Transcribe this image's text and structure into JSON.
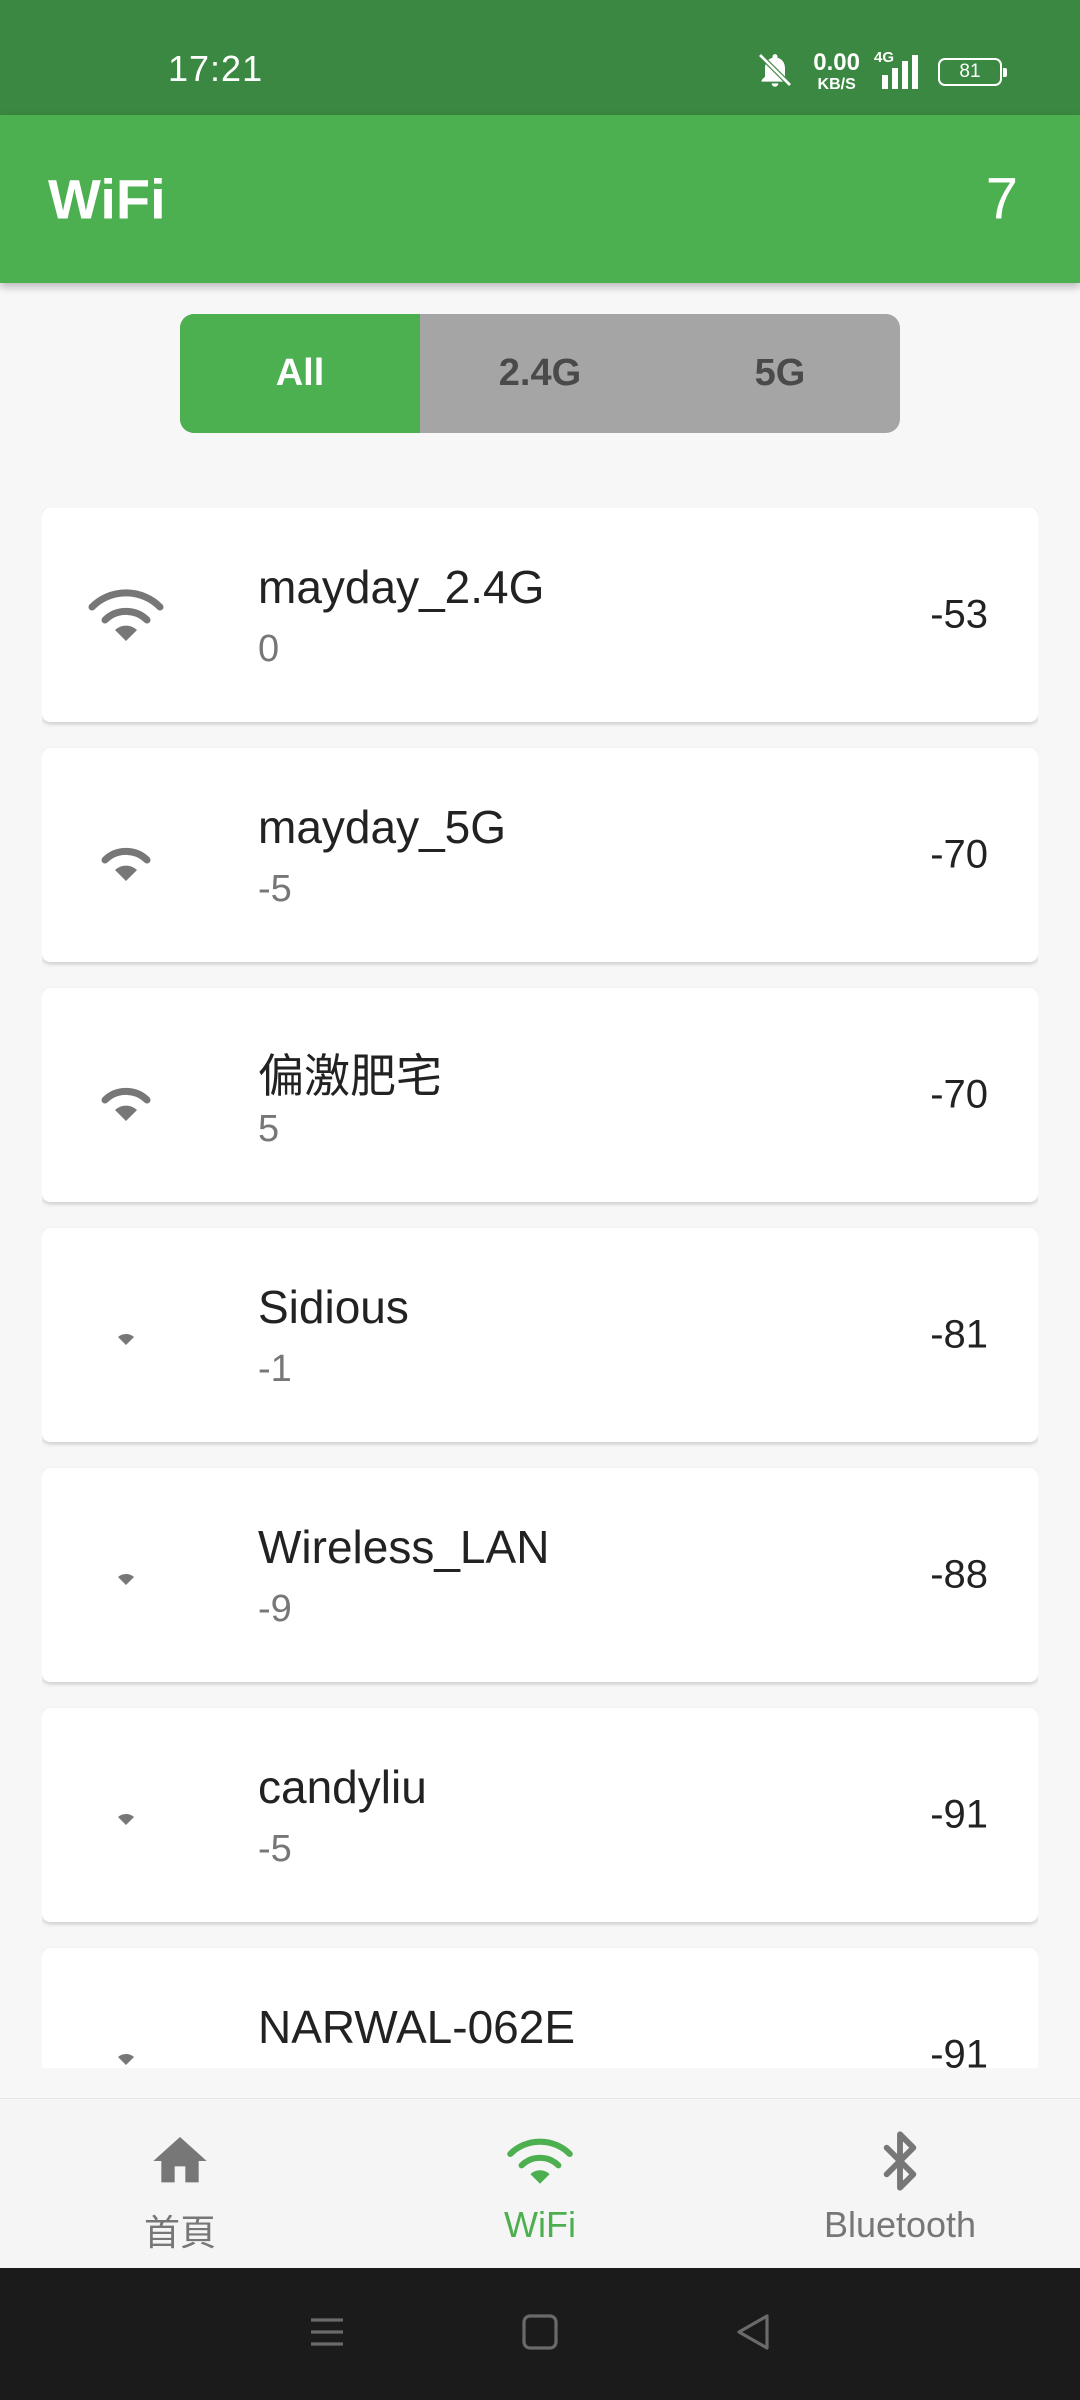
{
  "status_bar": {
    "time": "17:21",
    "net_speed_value": "0.00",
    "net_speed_unit": "KB/S",
    "network_type": "4G",
    "battery": "81"
  },
  "app_bar": {
    "title": "WiFi",
    "count": "7"
  },
  "filter": {
    "options": [
      "All",
      "2.4G",
      "5G"
    ],
    "selected": "All"
  },
  "networks": [
    {
      "ssid": "mayday_2.4G",
      "sub": "0",
      "rssi": "-53",
      "signal_icon": "wifi-strong-icon",
      "signal_level": 3
    },
    {
      "ssid": "mayday_5G",
      "sub": "-5",
      "rssi": "-70",
      "signal_icon": "wifi-medium-icon",
      "signal_level": 2
    },
    {
      "ssid": "偏激肥宅",
      "sub": "5",
      "rssi": "-70",
      "signal_icon": "wifi-medium-icon",
      "signal_level": 2
    },
    {
      "ssid": "Sidious",
      "sub": "-1",
      "rssi": "-81",
      "signal_icon": "wifi-weak-icon",
      "signal_level": 1
    },
    {
      "ssid": "Wireless_LAN",
      "sub": "-9",
      "rssi": "-88",
      "signal_icon": "wifi-weak-icon",
      "signal_level": 1
    },
    {
      "ssid": "candyliu",
      "sub": "-5",
      "rssi": "-91",
      "signal_icon": "wifi-weak-icon",
      "signal_level": 1
    },
    {
      "ssid": "NARWAL-062E",
      "sub": "",
      "rssi": "-91",
      "signal_icon": "wifi-weak-icon",
      "signal_level": 1
    }
  ],
  "bottom_nav": {
    "items": [
      {
        "label": "首頁",
        "icon": "home-icon"
      },
      {
        "label": "WiFi",
        "icon": "wifi-icon"
      },
      {
        "label": "Bluetooth",
        "icon": "bluetooth-icon"
      }
    ],
    "active": "WiFi"
  },
  "colors": {
    "status_bar": "#3a8841",
    "primary": "#4caf50",
    "segment_inactive": "#a5a5a5",
    "icon_gray": "#777777"
  }
}
